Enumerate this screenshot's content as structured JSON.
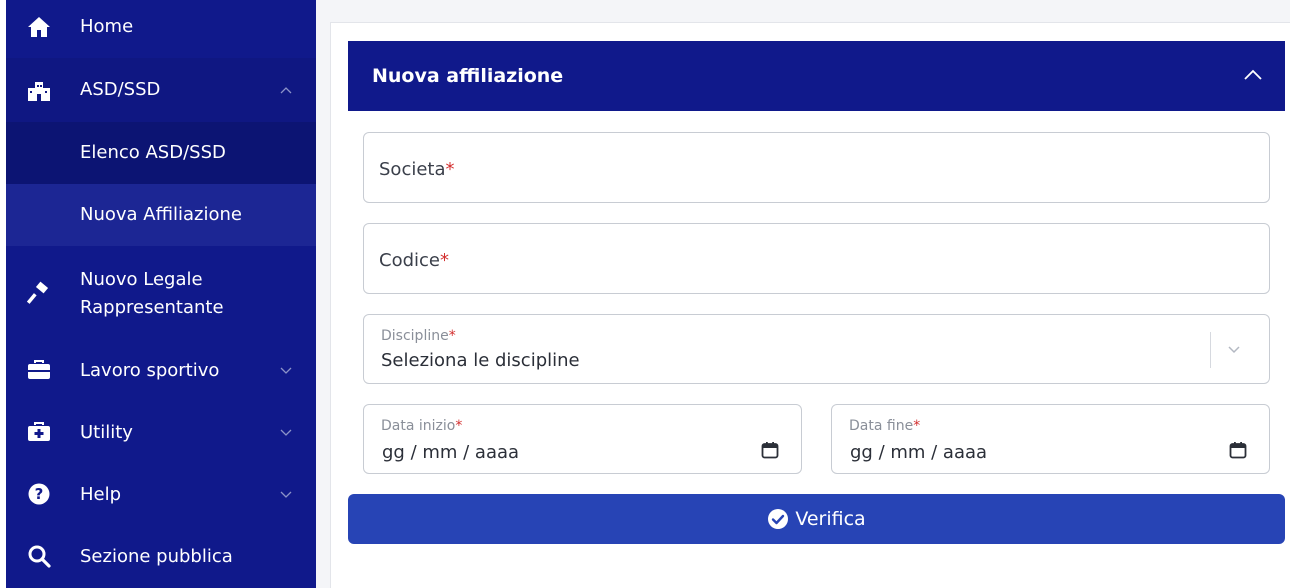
{
  "sidebar": {
    "items": [
      {
        "label": "Home",
        "icon": "home-icon"
      },
      {
        "label": "ASD/SSD",
        "icon": "buildings-icon"
      },
      {
        "label": "Elenco ASD/SSD"
      },
      {
        "label": "Nuova Affiliazione"
      },
      {
        "label_line1": "Nuovo Legale",
        "label_line2": "Rappresentante",
        "icon": "gavel-icon"
      },
      {
        "label": "Lavoro sportivo",
        "icon": "briefcase-icon"
      },
      {
        "label": "Utility",
        "icon": "medkit-icon"
      },
      {
        "label": "Help",
        "icon": "question-circle-icon"
      },
      {
        "label": "Sezione pubblica",
        "icon": "search-icon"
      }
    ]
  },
  "panel": {
    "title": "Nuova affiliazione"
  },
  "form": {
    "societa_label": "Societa",
    "codice_label": "Codice",
    "required_mark": "*",
    "discipline_label": "Discipline",
    "discipline_placeholder": "Seleziona le discipline",
    "data_inizio_label": "Data inizio",
    "data_inizio_value": "gg / mm / aaaa",
    "data_fine_label": "Data fine",
    "data_fine_value": "gg / mm / aaaa"
  },
  "actions": {
    "verifica_label": "Verifica"
  },
  "colors": {
    "sidebar": "#10198b",
    "header": "#10198b",
    "button": "#2744b5",
    "required": "#d32f2f"
  }
}
